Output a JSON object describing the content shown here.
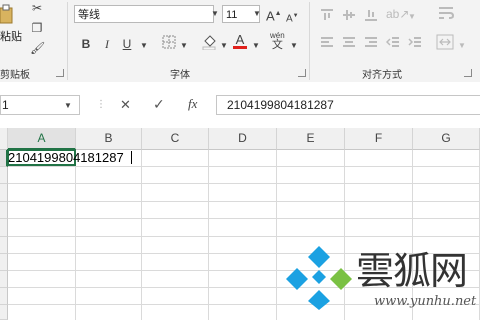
{
  "ribbon": {
    "clipboard": {
      "paste_label": "粘贴",
      "group_label": "剪贴板"
    },
    "font": {
      "font_name": "等线",
      "font_size": "11",
      "bold": "B",
      "italic": "I",
      "underline": "U",
      "group_label": "字体",
      "phonetic_label": "wén"
    },
    "alignment": {
      "group_label": "对齐方式"
    }
  },
  "formula_bar": {
    "name_box": "1",
    "cancel_icon": "✕",
    "enter_icon": "✓",
    "fx_label": "fx",
    "content": "2104199804181287"
  },
  "sheet": {
    "columns": [
      "A",
      "B",
      "C",
      "D",
      "E",
      "F",
      "G"
    ],
    "active_cell_value": "2104199804181287"
  },
  "watermark": {
    "brand": "雲狐网",
    "url": "www.yunhu.net"
  },
  "colors": {
    "accent": "#217346",
    "font_color_red": "#e0201b",
    "logo_blue": "#1ba1e2",
    "logo_green": "#7ac143"
  }
}
